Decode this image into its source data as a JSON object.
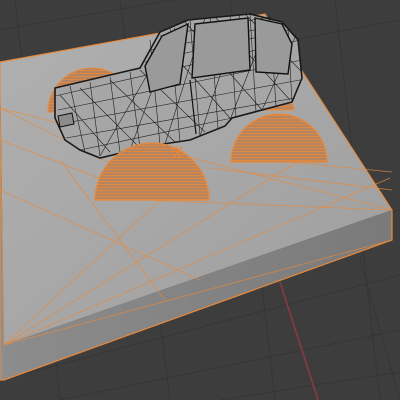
{
  "viewport": {
    "background_color": "#3d3d3d",
    "grid_color": "#353535",
    "x_axis_color": "#8a3a44"
  },
  "selection": {
    "outline_color": "#e8893a",
    "face_color": "#a8a8a8",
    "wire_color": "#1a1a1a"
  },
  "objects": [
    {
      "role": "base-slab",
      "selected": true
    },
    {
      "role": "car-body-wireframe",
      "selected": false
    },
    {
      "role": "wheel-front-left",
      "selected": true
    },
    {
      "role": "wheel-front-right",
      "selected": true
    },
    {
      "role": "wheel-rear-left",
      "selected": true
    },
    {
      "role": "wheel-rear-right",
      "selected": true
    }
  ],
  "origin_marker_icon": "object-origin-icon"
}
